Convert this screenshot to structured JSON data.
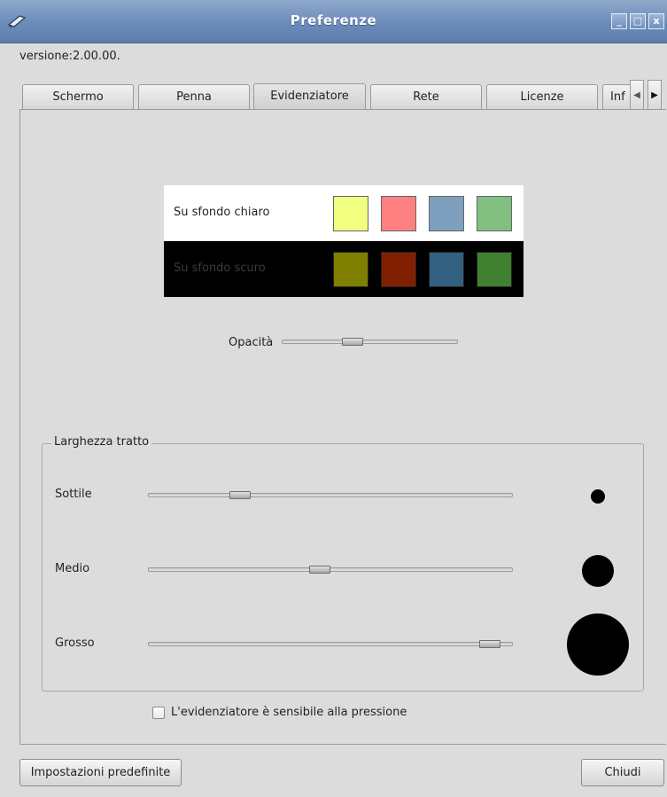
{
  "window": {
    "title": "Preferenze",
    "icon": "pen-icon",
    "controls": {
      "minimize": "_",
      "maximize": "□",
      "close": "x"
    }
  },
  "version_label": "versione:2.00.00.",
  "tabs": [
    {
      "label": "Schermo",
      "active": false
    },
    {
      "label": "Penna",
      "active": false
    },
    {
      "label": "Evidenziatore",
      "active": true
    },
    {
      "label": "Rete",
      "active": false
    },
    {
      "label": "Licenze",
      "active": false
    },
    {
      "label": "Inf",
      "active": false
    }
  ],
  "tab_scroll": {
    "left": "◀",
    "right": "▶"
  },
  "colors": {
    "light_label": "Su sfondo chiaro",
    "dark_label": "Su sfondo scuro",
    "light_swatches": [
      "#f0ff80",
      "#ff8080",
      "#7f9fbf",
      "#80bf80"
    ],
    "dark_swatches": [
      "#808000",
      "#802000",
      "#336080",
      "#408030"
    ]
  },
  "opacity": {
    "label": "Opacità",
    "value": 0.4
  },
  "stroke_width": {
    "title": "Larghezza tratto",
    "rows": [
      {
        "label": "Sottile",
        "value": 0.25
      },
      {
        "label": "Medio",
        "value": 0.47
      },
      {
        "label": "Grosso",
        "value": 0.94
      }
    ]
  },
  "pressure_checkbox": {
    "label": "L'evidenziatore è sensibile alla pressione",
    "checked": false
  },
  "buttons": {
    "defaults": "Impostazioni predefinite",
    "close": "Chiudi"
  }
}
